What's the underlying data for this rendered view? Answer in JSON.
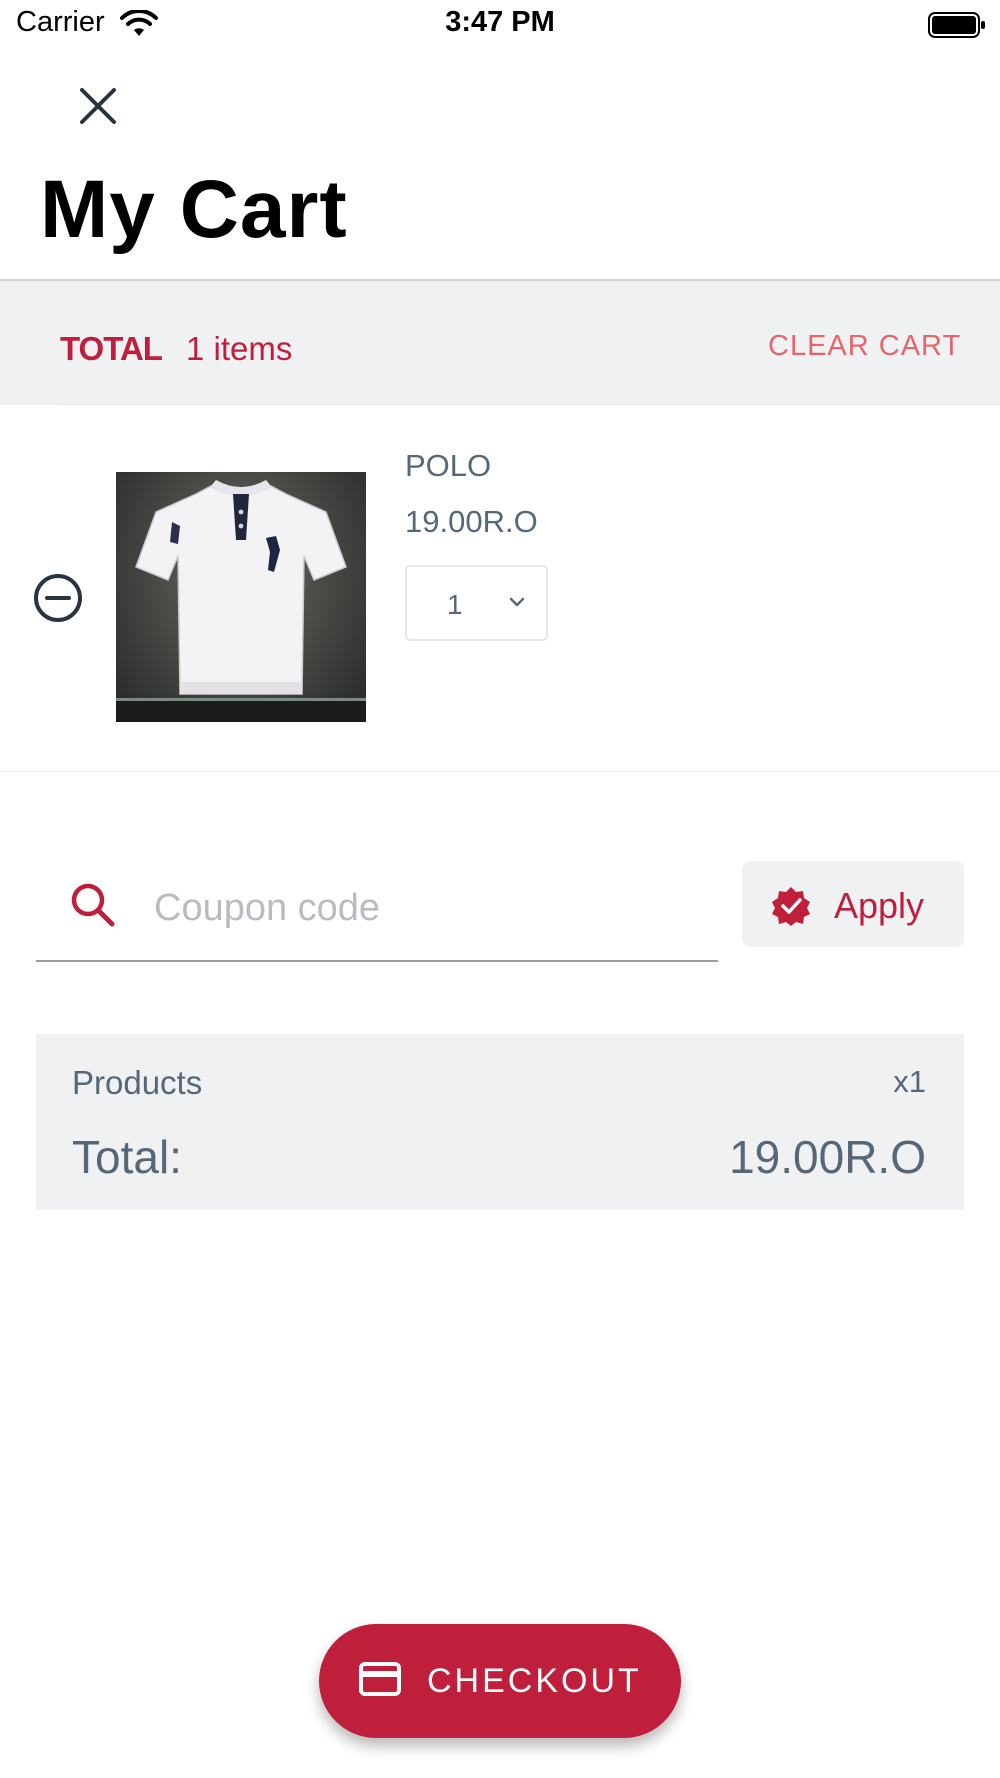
{
  "status_bar": {
    "carrier": "Carrier",
    "time": "3:47 PM"
  },
  "page": {
    "title": "My Cart",
    "close_icon": "close-icon"
  },
  "cart_header": {
    "total_label": "TOTAL",
    "item_count": "1 items",
    "clear_cart_label": "CLEAR CART"
  },
  "cart_items": [
    {
      "name": "POLO",
      "price": "19.00R.O",
      "quantity": "1",
      "remove_icon": "minus-circle-icon",
      "image": "white polo shirt"
    }
  ],
  "coupon": {
    "placeholder": "Coupon code",
    "value": "",
    "apply_label": "Apply",
    "search_icon": "search-icon",
    "apply_icon": "verified-badge-icon"
  },
  "summary": {
    "products_label": "Products",
    "products_qty": "x1",
    "total_label": "Total:",
    "total_value": "19.00R.O"
  },
  "checkout": {
    "label": "CHECKOUT",
    "icon": "credit-card-icon"
  },
  "colors": {
    "accent": "#bf1f3b",
    "clear_cart": "#e8646b",
    "text_muted": "#566877",
    "panel_bg": "#f0f1f3"
  }
}
